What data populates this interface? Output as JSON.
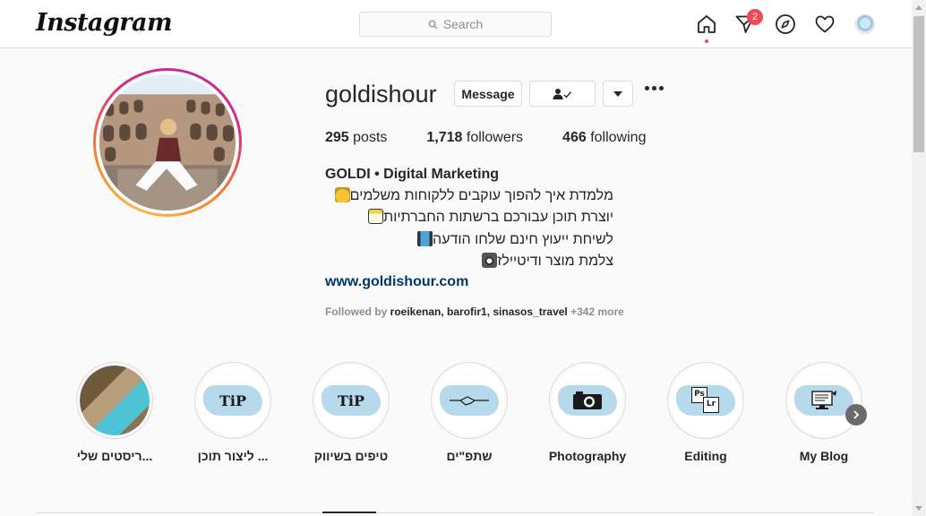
{
  "app": {
    "logo_text": "Instagram"
  },
  "search": {
    "placeholder": "Search"
  },
  "nav": {
    "icons": [
      "home-icon",
      "direct-message-icon",
      "explore-compass-icon",
      "activity-heart-icon",
      "profile-avatar-icon"
    ],
    "dm_badge": "2"
  },
  "profile": {
    "username": "goldishour",
    "message_label": "Message",
    "posts_count": "295",
    "posts_label": "posts",
    "followers_count": "1,718",
    "followers_label": "followers",
    "following_count": "466",
    "following_label": "following",
    "full_name": "GOLDI • Digital Marketing",
    "bio_lines": [
      "מלמדת איך להפוך עוקבים ללקוחות משלמים",
      "יוצרת תוכן עבורכם ברשתות החברתיות",
      "לשיחת ייעוץ חינם שלחו הודעה",
      "צלמת מוצר ודיטיילז"
    ],
    "website": "www.goldishour.com",
    "followed_by_prefix": "Followed by ",
    "followed_by_names": "roeikenan, barofir1, sinasos_travel",
    "followed_by_more": " +342 more"
  },
  "highlights": [
    {
      "label": "ריסטים שלי..."
    },
    {
      "label": "ליצור תוכן ...",
      "cover_text": "TiP"
    },
    {
      "label": "טיפים בשיווק",
      "cover_text": "TiP"
    },
    {
      "label": "שתפ\"ים"
    },
    {
      "label": "Photography"
    },
    {
      "label": "Editing",
      "cover_text_1": "Ps",
      "cover_text_2": "Lr"
    },
    {
      "label": "My Blog"
    }
  ],
  "colors": {
    "notification_red": "#ed4956",
    "link_blue": "#00376b",
    "highlight_splash": "#b7d9ec"
  }
}
